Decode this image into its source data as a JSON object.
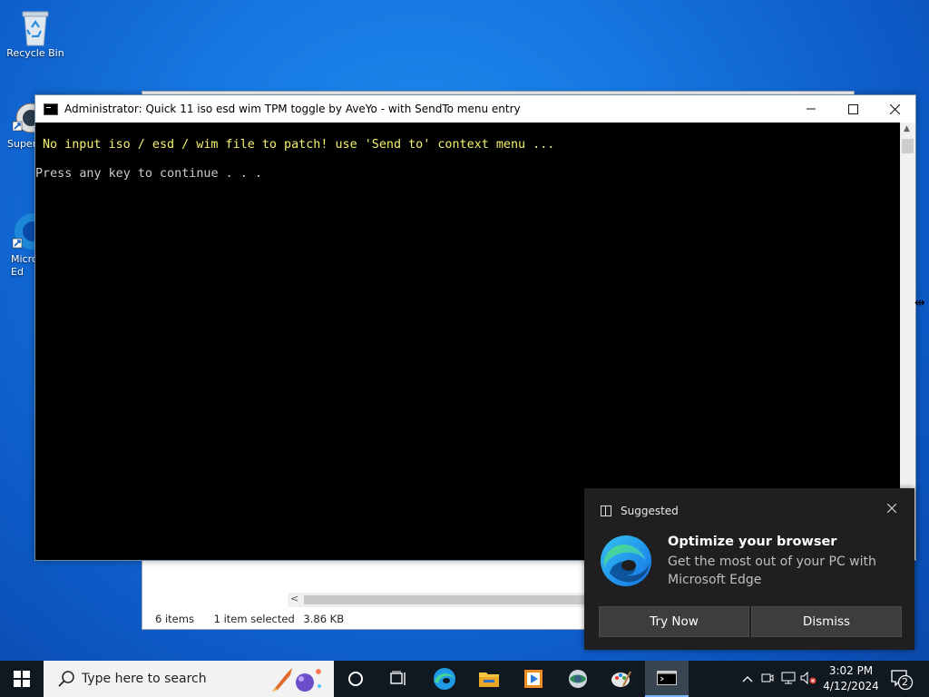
{
  "desktop": {
    "icons": [
      {
        "label": "Recycle Bin"
      },
      {
        "label": "Super"
      },
      {
        "label": "Micro\nEd"
      }
    ]
  },
  "explorer": {
    "status_items": "6 items",
    "status_selected": "1 item selected",
    "status_size": "3.86 KB"
  },
  "console": {
    "title": "Administrator:  Quick 11 iso esd wim TPM toggle by AveYo - with SendTo menu entry",
    "line1": "No input iso / esd / wim file to patch! use 'Send to' context menu ...",
    "line2": "Press any key to continue . . ."
  },
  "toast": {
    "header": "Suggested",
    "headline": "Optimize your browser",
    "body": "Get the most out of your PC with Microsoft Edge",
    "primary_button": "Try Now",
    "secondary_button": "Dismiss"
  },
  "taskbar": {
    "search_placeholder": "Type here to search",
    "clock_time": "3:02 PM",
    "clock_date": "4/12/2024",
    "notification_count": "2"
  },
  "colors": {
    "desktop_bg": "#1677e0",
    "console_yellow": "#f3f36e",
    "console_gray": "#cccccc",
    "toast_bg": "#1f1f1f",
    "taskbar_bg": "#101820"
  }
}
